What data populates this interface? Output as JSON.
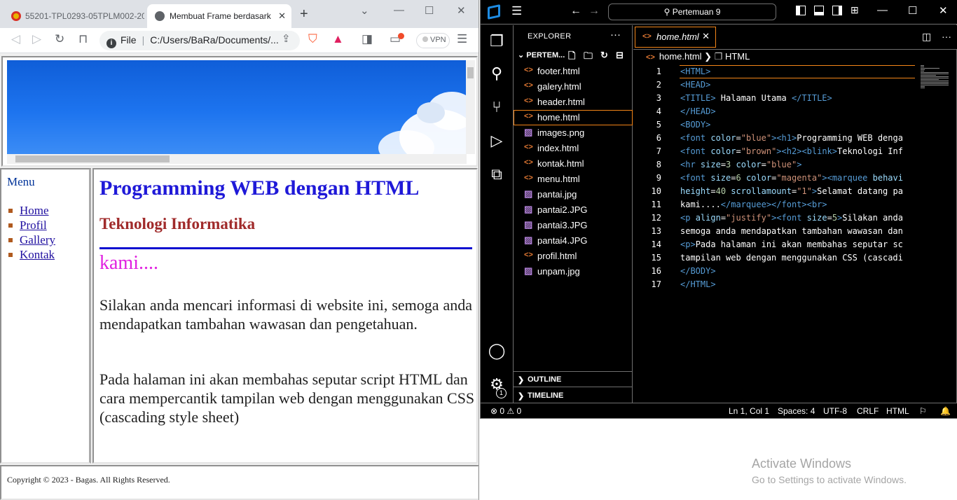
{
  "browser": {
    "tabs": [
      {
        "title": "55201-TPL0293-05TPLM002-20"
      },
      {
        "title": "Membuat Frame berdasark"
      }
    ],
    "address_scheme": "File",
    "address_path": "C:/Users/BaRa/Documents/...",
    "vpn_label": "VPN"
  },
  "page": {
    "menu_title": "Menu",
    "menu_links": [
      "Home",
      "Profil",
      "Gallery",
      "Kontak"
    ],
    "heading1": "Programming WEB dengan HTML",
    "heading2": "Teknologi Informatika",
    "marquee_text": "kami....",
    "paragraph1": "Silakan anda mencari informasi di website ini, semoga anda mendapatkan tambahan wawasan dan pengetahuan.",
    "paragraph2": "Pada halaman ini akan membahas seputar script HTML dan cara mempercantik tampilan web dengan menggunakan CSS (cascading style sheet)",
    "footer": "Copyright © 2023 - Bagas. All Rights Reserved."
  },
  "vscode": {
    "command_center": "Pertemuan 9",
    "explorer_title": "EXPLORER",
    "folder_name": "PERTEM...",
    "files": [
      {
        "name": "footer.html",
        "type": "html"
      },
      {
        "name": "galery.html",
        "type": "html"
      },
      {
        "name": "header.html",
        "type": "html"
      },
      {
        "name": "home.html",
        "type": "html",
        "selected": true
      },
      {
        "name": "images.png",
        "type": "image"
      },
      {
        "name": "index.html",
        "type": "html"
      },
      {
        "name": "kontak.html",
        "type": "html"
      },
      {
        "name": "menu.html",
        "type": "html"
      },
      {
        "name": "pantai.jpg",
        "type": "image"
      },
      {
        "name": "pantai2.JPG",
        "type": "image"
      },
      {
        "name": "pantai3.JPG",
        "type": "image"
      },
      {
        "name": "pantai4.JPG",
        "type": "image"
      },
      {
        "name": "profil.html",
        "type": "html"
      },
      {
        "name": "unpam.jpg",
        "type": "image"
      }
    ],
    "outline_label": "OUTLINE",
    "timeline_label": "TIMELINE",
    "editor_tab": "home.html",
    "breadcrumb_file": "home.html",
    "breadcrumb_symbol": "HTML",
    "code_lines": [
      [
        [
          "tg",
          "<HTML>"
        ]
      ],
      [
        [
          "tg",
          "<HEAD>"
        ]
      ],
      [
        [
          "tg",
          "<TITLE>"
        ],
        [
          "tx",
          " Halaman Utama "
        ],
        [
          "tg",
          "</TITLE>"
        ]
      ],
      [
        [
          "tg",
          "</HEAD>"
        ]
      ],
      [
        [
          "tg",
          "<BODY>"
        ]
      ],
      [
        [
          "tg",
          "<font "
        ],
        [
          "at",
          "color"
        ],
        [
          "tx",
          "="
        ],
        [
          "st",
          "\"blue\""
        ],
        [
          "tg",
          ">"
        ],
        [
          "tg",
          "<h1>"
        ],
        [
          "tx",
          "Programming WEB denga"
        ]
      ],
      [
        [
          "tg",
          "<font "
        ],
        [
          "at",
          "color"
        ],
        [
          "tx",
          "="
        ],
        [
          "st",
          "\"brown\""
        ],
        [
          "tg",
          ">"
        ],
        [
          "tg",
          "<h2>"
        ],
        [
          "tg",
          "<blink>"
        ],
        [
          "tx",
          "Teknologi Inf"
        ]
      ],
      [
        [
          "tg",
          "<hr "
        ],
        [
          "at",
          "size"
        ],
        [
          "tx",
          "="
        ],
        [
          "nm",
          "3"
        ],
        [
          "at",
          " color"
        ],
        [
          "tx",
          "="
        ],
        [
          "st",
          "\"blue\""
        ],
        [
          "tg",
          ">"
        ]
      ],
      [
        [
          "tg",
          "<font "
        ],
        [
          "at",
          "size"
        ],
        [
          "tx",
          "="
        ],
        [
          "nm",
          "6"
        ],
        [
          "at",
          " color"
        ],
        [
          "tx",
          "="
        ],
        [
          "st",
          "\"magenta\""
        ],
        [
          "tg",
          ">"
        ],
        [
          "tg",
          "<marquee "
        ],
        [
          "at",
          "behavi"
        ]
      ],
      [
        [
          "at",
          "height"
        ],
        [
          "tx",
          "="
        ],
        [
          "nm",
          "40"
        ],
        [
          "at",
          " scrollamount"
        ],
        [
          "tx",
          "="
        ],
        [
          "st",
          "\"1\""
        ],
        [
          "tg",
          ">"
        ],
        [
          "tx",
          "Selamat datang pa"
        ]
      ],
      [
        [
          "tx",
          "kami...."
        ],
        [
          "tg",
          "</marquee>"
        ],
        [
          "tg",
          "</font>"
        ],
        [
          "tg",
          "<br>"
        ]
      ],
      [
        [
          "tg",
          "<p "
        ],
        [
          "at",
          "align"
        ],
        [
          "tx",
          "="
        ],
        [
          "st",
          "\"justify\""
        ],
        [
          "tg",
          ">"
        ],
        [
          "tg",
          "<font "
        ],
        [
          "at",
          "size"
        ],
        [
          "tx",
          "="
        ],
        [
          "nm",
          "5"
        ],
        [
          "tg",
          ">"
        ],
        [
          "tx",
          "Silakan anda"
        ]
      ],
      [
        [
          "tx",
          "semoga anda mendapatkan tambahan wawasan dan"
        ]
      ],
      [
        [
          "tg",
          "<p>"
        ],
        [
          "tx",
          "Pada halaman ini akan membahas seputar sc"
        ]
      ],
      [
        [
          "tx",
          "tampilan web dengan menggunakan CSS (cascadi"
        ]
      ],
      [
        [
          "tg",
          "</BODY>"
        ]
      ],
      [
        [
          "tg",
          "</HTML>"
        ]
      ]
    ],
    "status": {
      "errors": "0",
      "warnings": "0",
      "position": "Ln 1, Col 1",
      "spaces": "Spaces: 4",
      "encoding": "UTF-8",
      "eol": "CRLF",
      "language": "HTML",
      "notification_badge": "1"
    }
  },
  "windows_watermark": {
    "line1": "Activate Windows",
    "line2": "Go to Settings to activate Windows."
  }
}
